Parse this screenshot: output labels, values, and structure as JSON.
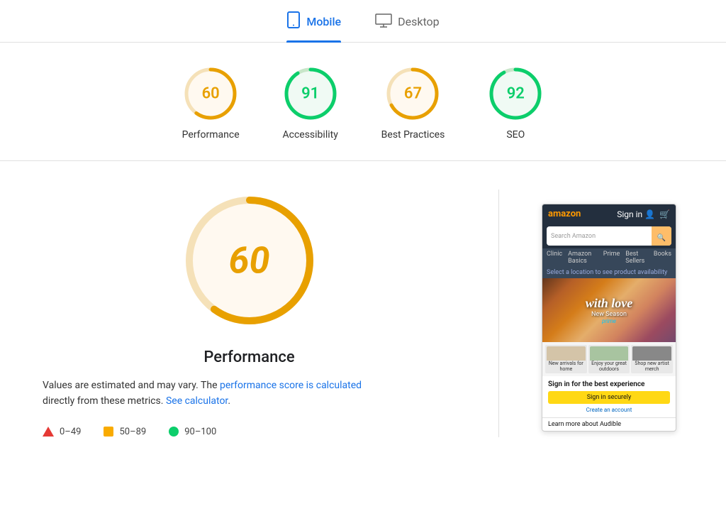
{
  "tabs": [
    {
      "id": "mobile",
      "label": "Mobile",
      "active": true,
      "icon": "mobile-icon"
    },
    {
      "id": "desktop",
      "label": "Desktop",
      "active": false,
      "icon": "desktop-icon"
    }
  ],
  "scores": [
    {
      "id": "performance",
      "value": 60,
      "label": "Performance",
      "color": "#e8a000",
      "bg": "#fff3e0",
      "track": "#f5e1b8",
      "pct": 60
    },
    {
      "id": "accessibility",
      "value": 91,
      "label": "Accessibility",
      "color": "#0cce6b",
      "bg": "#e8f5e9",
      "track": "#c8e6c9",
      "pct": 91
    },
    {
      "id": "best-practices",
      "value": 67,
      "label": "Best Practices",
      "color": "#e8a000",
      "bg": "#fff3e0",
      "track": "#f5e1b8",
      "pct": 67
    },
    {
      "id": "seo",
      "value": 92,
      "label": "SEO",
      "color": "#0cce6b",
      "bg": "#e8f5e9",
      "track": "#c8e6c9",
      "pct": 92
    }
  ],
  "detail": {
    "score": 60,
    "score_color": "#e8a000",
    "title": "Performance",
    "description_prefix": "Values are estimated and may vary. The",
    "link1_text": "performance score is calculated",
    "link1_suffix": "directly from these metrics.",
    "link2_text": "See calculator",
    "description_suffix": "."
  },
  "legend": [
    {
      "id": "low",
      "range": "0–49",
      "type": "triangle",
      "color": "#e53935"
    },
    {
      "id": "mid",
      "range": "50–89",
      "type": "square",
      "color": "#f9ab00"
    },
    {
      "id": "high",
      "range": "90–100",
      "type": "circle",
      "color": "#0cce6b"
    }
  ],
  "phone": {
    "logo": "amazon",
    "search_placeholder": "Search Amazon",
    "nav_items": [
      "Clinic",
      "Amazon Basics",
      "Prime",
      "Best Sellers",
      "Books"
    ],
    "banner_text": "Select a location to see product availability",
    "hero_line1": "with love",
    "hero_line2": "New Season",
    "hero_badge": "prime",
    "grid_items": [
      {
        "label": "New arrivals for home"
      },
      {
        "label": "Enjoy your great outdoors"
      },
      {
        "label": "Shop new artist merch"
      }
    ],
    "signin_title": "Sign in for the best experience",
    "signin_btn": "Sign in securely",
    "create_account": "Create an account",
    "audible_text": "Learn more about Audible"
  }
}
